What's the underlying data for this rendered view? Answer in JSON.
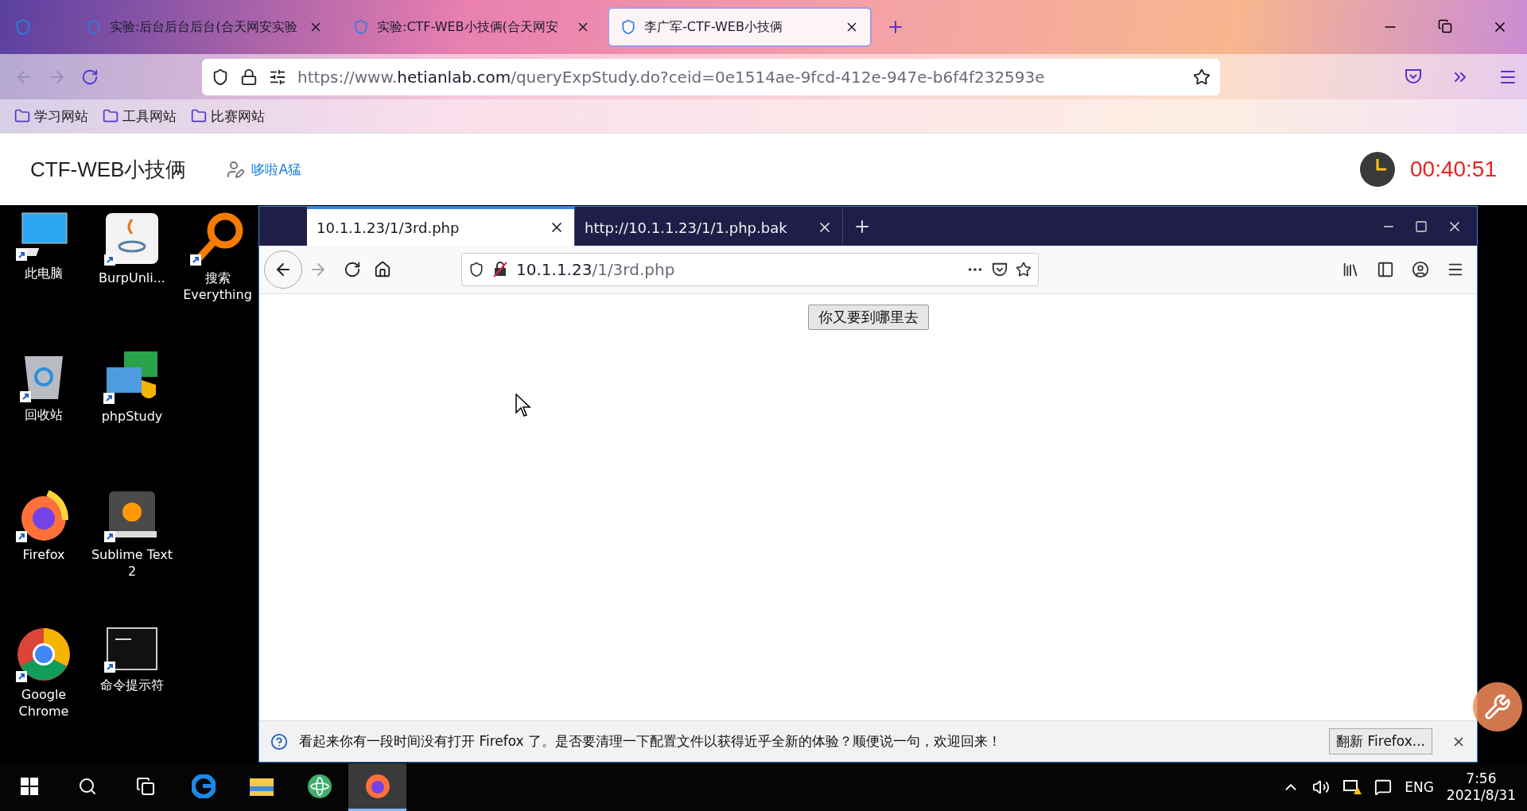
{
  "browser": {
    "tabs": [
      {
        "title": "实验:后台后台后台(合天网安实验",
        "selected": false
      },
      {
        "title": "实验:CTF-WEB小技俩(合天网安",
        "selected": false
      },
      {
        "title": "李广军-CTF-WEB小技俩",
        "selected": true
      }
    ],
    "url": {
      "prefix": "https://www.",
      "host": "hetianlab.com",
      "path": "/queryExpStudy.do?ceid=0e1514ae-9fcd-412e-947e-b6f4f232593e"
    },
    "bookmarks": [
      "学习网站",
      "工具网站",
      "比赛网站"
    ]
  },
  "page_header": {
    "title": "CTF-WEB小技俩",
    "user": "哆啦A猛",
    "timer": "00:40:51"
  },
  "desktop": {
    "icons": [
      {
        "label": "此电脑"
      },
      {
        "label": "BurpUnli..."
      },
      {
        "label": "搜索 Everything"
      },
      {
        "label": "回收站"
      },
      {
        "label": "phpStudy"
      },
      {
        "label": "Firefox"
      },
      {
        "label": "Sublime Text 2"
      },
      {
        "label": "Google Chrome"
      },
      {
        "label": "命令提示符"
      }
    ]
  },
  "inner_browser": {
    "tabs": [
      {
        "title": "10.1.1.23/1/3rd.php",
        "selected": true
      },
      {
        "title": "http://10.1.1.23/1/1.php.bak",
        "selected": false
      }
    ],
    "url": {
      "host": "10.1.1.23",
      "path": "/1/3rd.php"
    },
    "page_button": "你又要到哪里去",
    "notification": {
      "message": "看起来你有一段时间没有打开 Firefox 了。是否要清理一下配置文件以获得近乎全新的体验？顺便说一句，欢迎回来！",
      "button": "翻新 Firefox..."
    }
  },
  "taskbar": {
    "apps": [
      {
        "selected": false
      },
      {
        "selected": false
      },
      {
        "selected": false
      },
      {
        "selected": false
      },
      {
        "selected": false
      },
      {
        "selected": false
      },
      {
        "selected": true
      }
    ],
    "language": "ENG",
    "time": "7:56",
    "date": "2021/8/31"
  }
}
